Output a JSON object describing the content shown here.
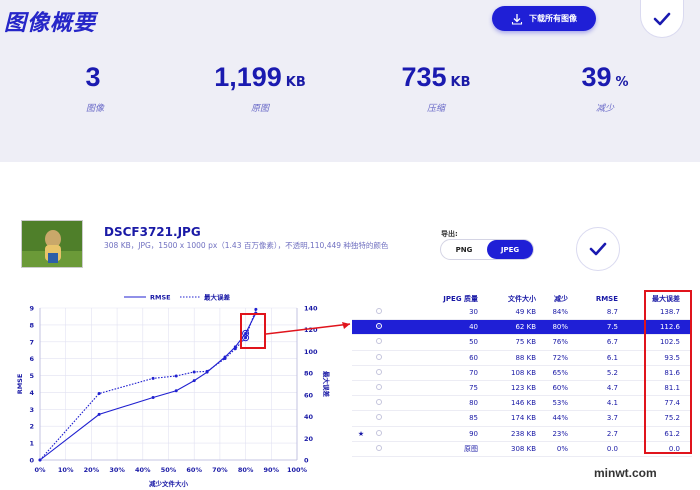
{
  "header": {
    "title": "图像概要",
    "download_label": "下载所有图像"
  },
  "stats": [
    {
      "value": "3",
      "unit": "",
      "label": "图像"
    },
    {
      "value": "1,199",
      "unit": "KB",
      "label": "原图"
    },
    {
      "value": "735",
      "unit": "KB",
      "label": "压缩"
    },
    {
      "value": "39",
      "unit": "%",
      "label": "减少"
    }
  ],
  "file": {
    "name": "DSCF3721.JPG",
    "meta": "308 KB，JPG，1500 x 1000 px（1.43 百万像素），不透明,110,449 种独特的颜色"
  },
  "export": {
    "label": "导出:",
    "options": [
      "PNG",
      "JPEG"
    ],
    "selected": "JPEG"
  },
  "table": {
    "headers": [
      "JPEG 质量",
      "文件大小",
      "减少",
      "RMSE",
      "最大误差"
    ],
    "rows": [
      {
        "q": "30",
        "size": "49 KB",
        "red": "84%",
        "rmse": "8.7",
        "max": "138.7",
        "selected": false,
        "star": false
      },
      {
        "q": "40",
        "size": "62 KB",
        "red": "80%",
        "rmse": "7.5",
        "max": "112.6",
        "selected": true,
        "star": false
      },
      {
        "q": "50",
        "size": "75 KB",
        "red": "76%",
        "rmse": "6.7",
        "max": "102.5",
        "selected": false,
        "star": false
      },
      {
        "q": "60",
        "size": "88 KB",
        "red": "72%",
        "rmse": "6.1",
        "max": "93.5",
        "selected": false,
        "star": false
      },
      {
        "q": "70",
        "size": "108 KB",
        "red": "65%",
        "rmse": "5.2",
        "max": "81.6",
        "selected": false,
        "star": false
      },
      {
        "q": "75",
        "size": "123 KB",
        "red": "60%",
        "rmse": "4.7",
        "max": "81.1",
        "selected": false,
        "star": false
      },
      {
        "q": "80",
        "size": "146 KB",
        "red": "53%",
        "rmse": "4.1",
        "max": "77.4",
        "selected": false,
        "star": false
      },
      {
        "q": "85",
        "size": "174 KB",
        "red": "44%",
        "rmse": "3.7",
        "max": "75.2",
        "selected": false,
        "star": false
      },
      {
        "q": "90",
        "size": "238 KB",
        "red": "23%",
        "rmse": "2.7",
        "max": "61.2",
        "selected": false,
        "star": true
      },
      {
        "q": "原图",
        "size": "308 KB",
        "red": "0%",
        "rmse": "0.0",
        "max": "0.0",
        "selected": false,
        "star": false
      }
    ],
    "star_glyph": "★"
  },
  "chart_data": {
    "type": "line",
    "xlabel": "减少文件大小",
    "ylabel_left": "RMSE",
    "ylabel_right": "最大误差",
    "x_ticks": [
      "0%",
      "10%",
      "20%",
      "30%",
      "40%",
      "50%",
      "60%",
      "70%",
      "80%",
      "90%",
      "100%"
    ],
    "y_left_ticks": [
      "0",
      "1",
      "2",
      "3",
      "4",
      "5",
      "6",
      "7",
      "8",
      "9"
    ],
    "y_right_ticks": [
      "0",
      "20",
      "40",
      "60",
      "80",
      "100",
      "120",
      "140"
    ],
    "xlim": [
      0,
      100
    ],
    "ylim_left": [
      0,
      9
    ],
    "ylim_right": [
      0,
      140
    ],
    "legend": [
      "RMSE",
      "最大误差"
    ],
    "series": [
      {
        "name": "RMSE",
        "style": "solid",
        "x": [
          0,
          23,
          44,
          53,
          60,
          65,
          72,
          76,
          80,
          84
        ],
        "y": [
          0,
          2.7,
          3.7,
          4.1,
          4.7,
          5.2,
          6.1,
          6.7,
          7.5,
          8.7
        ]
      },
      {
        "name": "最大误差",
        "style": "dotted",
        "x": [
          0,
          23,
          44,
          53,
          60,
          65,
          72,
          76,
          80,
          84
        ],
        "y": [
          0,
          61.2,
          75.2,
          77.4,
          81.1,
          81.6,
          93.5,
          102.5,
          112.6,
          138.7
        ]
      }
    ]
  },
  "watermark": "minwt.com",
  "colors": {
    "accent": "#1f1fd6",
    "highlight": "#e0141c",
    "summary_bg": "#eeeef6"
  }
}
